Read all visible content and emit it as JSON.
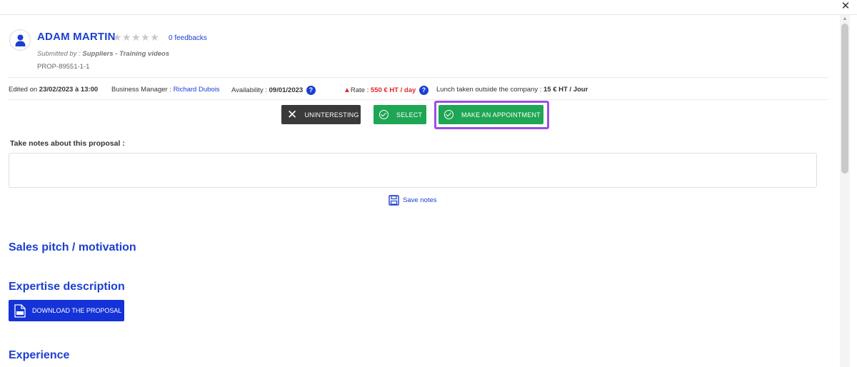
{
  "window": {
    "close_label": "✕"
  },
  "profile": {
    "name": "ADAM MARTIN",
    "stars": "★★★★★",
    "feedbacks": "0 feedbacks",
    "submitted_prefix": "Submitted by : ",
    "submitted_by": "Suppliers - Training videos",
    "reference": "PROP-89551-1-1"
  },
  "info": {
    "edited_prefix": "Edited on ",
    "edited_value": "23/02/2023 à 13:00",
    "bm_prefix": "Business Manager : ",
    "bm_value": "Richard Dubois",
    "availability_prefix": "Availability : ",
    "availability_value": "09/01/2023",
    "rate_prefix": "Rate : ",
    "rate_value": "550 € HT / day",
    "lunch_prefix": "Lunch taken outside the company : ",
    "lunch_value": "15 € HT / Jour",
    "help_glyph": "?"
  },
  "actions": {
    "uninteresting": "UNINTERESTING",
    "select": "SELECT",
    "appointment": "MAKE AN APPOINTMENT"
  },
  "notes": {
    "label": "Take notes about this proposal :",
    "value": "",
    "save_label": "Save notes"
  },
  "sections": {
    "pitch": "Sales pitch / motivation",
    "expertise": "Expertise description",
    "download": "DOWNLOAD THE PROPOSAL",
    "experience": "Experience"
  },
  "colors": {
    "primary": "#1c3fd1",
    "success": "#1fa654",
    "dark": "#3a3a3a",
    "danger": "#e5262a",
    "highlight": "#9b4de8"
  }
}
